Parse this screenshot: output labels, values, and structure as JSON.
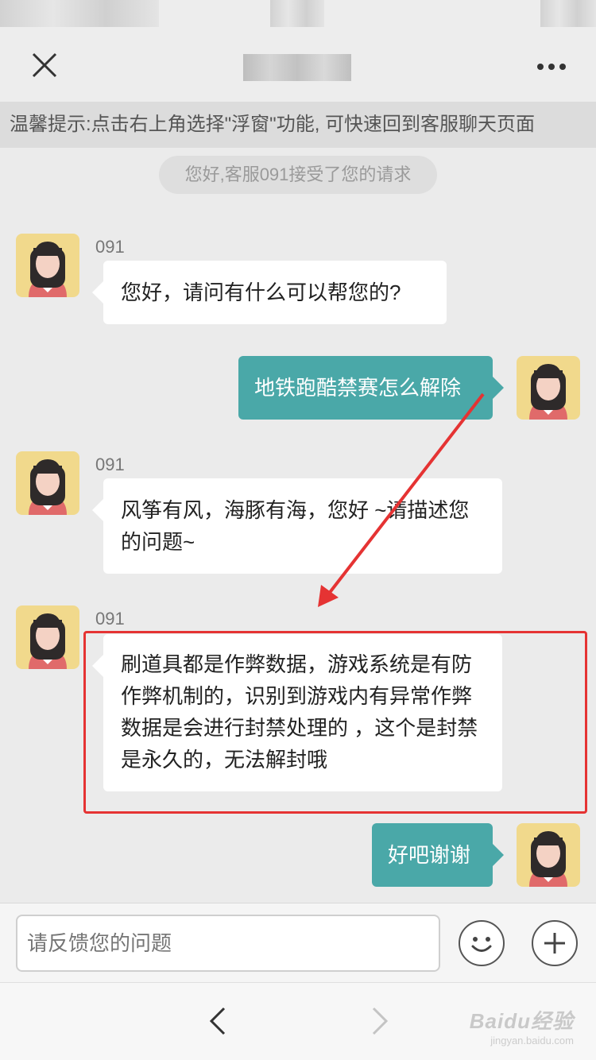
{
  "header": {
    "close_icon": "close-icon",
    "more_icon": "more-icon"
  },
  "tip": {
    "text": "温馨提示:点击右上角选择\"浮窗\"功能, 可快速回到客服聊天页面"
  },
  "notice": {
    "text": "您好,客服091接受了您的请求"
  },
  "messages": [
    {
      "side": "agent",
      "name": "091",
      "text": "您好，请问有什么可以帮您的?"
    },
    {
      "side": "user",
      "text": "地铁跑酷禁赛怎么解除"
    },
    {
      "side": "agent",
      "name": "091",
      "text": "风筝有风，海豚有海，您好 ~请描述您的问题~"
    },
    {
      "side": "agent",
      "name": "091",
      "text": "刷道具都是作弊数据，游戏系统是有防作弊机制的，识别到游戏内有异常作弊数据是会进行封禁处理的 ，这个是封禁是永久的，无法解封哦"
    },
    {
      "side": "user",
      "text": "好吧谢谢"
    }
  ],
  "input": {
    "placeholder": "请反馈您的问题"
  },
  "buttons": {
    "emoji_icon": "smile-icon",
    "plus_icon": "plus-icon"
  },
  "browser": {
    "back_icon": "chevron-left-icon",
    "forward_icon": "chevron-right-icon"
  },
  "watermark": {
    "logo": "Baidu经验",
    "url": "jingyan.baidu.com"
  },
  "colors": {
    "user_bubble": "#4aa8a8",
    "annotation_red": "#e53333",
    "background": "#ebebeb"
  }
}
